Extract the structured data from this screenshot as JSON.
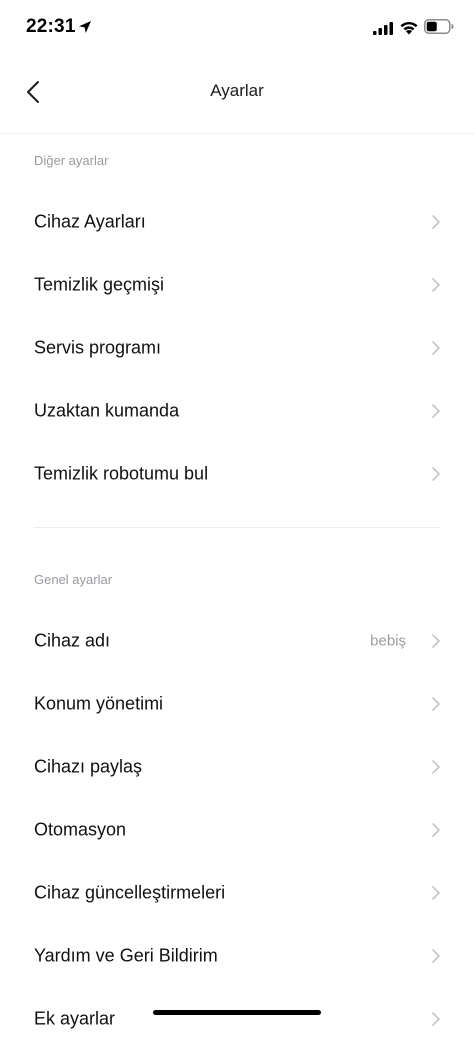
{
  "status_bar": {
    "time": "22:31",
    "icons": [
      "location-arrow-icon",
      "cellular-signal-icon",
      "wifi-icon",
      "battery-icon"
    ]
  },
  "nav": {
    "title": "Ayarlar",
    "back_icon": "chevron-left-icon"
  },
  "sections": [
    {
      "header": "Diğer ayarlar",
      "items": [
        {
          "label": "Cihaz Ayarları"
        },
        {
          "label": "Temizlik geçmişi"
        },
        {
          "label": "Servis programı"
        },
        {
          "label": "Uzaktan kumanda"
        },
        {
          "label": "Temizlik robotumu bul"
        }
      ]
    },
    {
      "header": "Genel ayarlar",
      "items": [
        {
          "label": "Cihaz adı",
          "value": "bebiş"
        },
        {
          "label": "Konum yönetimi"
        },
        {
          "label": "Cihazı paylaş"
        },
        {
          "label": "Otomasyon"
        },
        {
          "label": "Cihaz güncelleştirmeleri"
        },
        {
          "label": "Yardım ve Geri Bildirim"
        },
        {
          "label": "Ek ayarlar"
        }
      ]
    }
  ],
  "colors": {
    "text_primary": "#111111",
    "text_secondary": "#9a9aa0",
    "chevron": "#c4c4c8",
    "divider": "#ececec",
    "background": "#ffffff"
  }
}
